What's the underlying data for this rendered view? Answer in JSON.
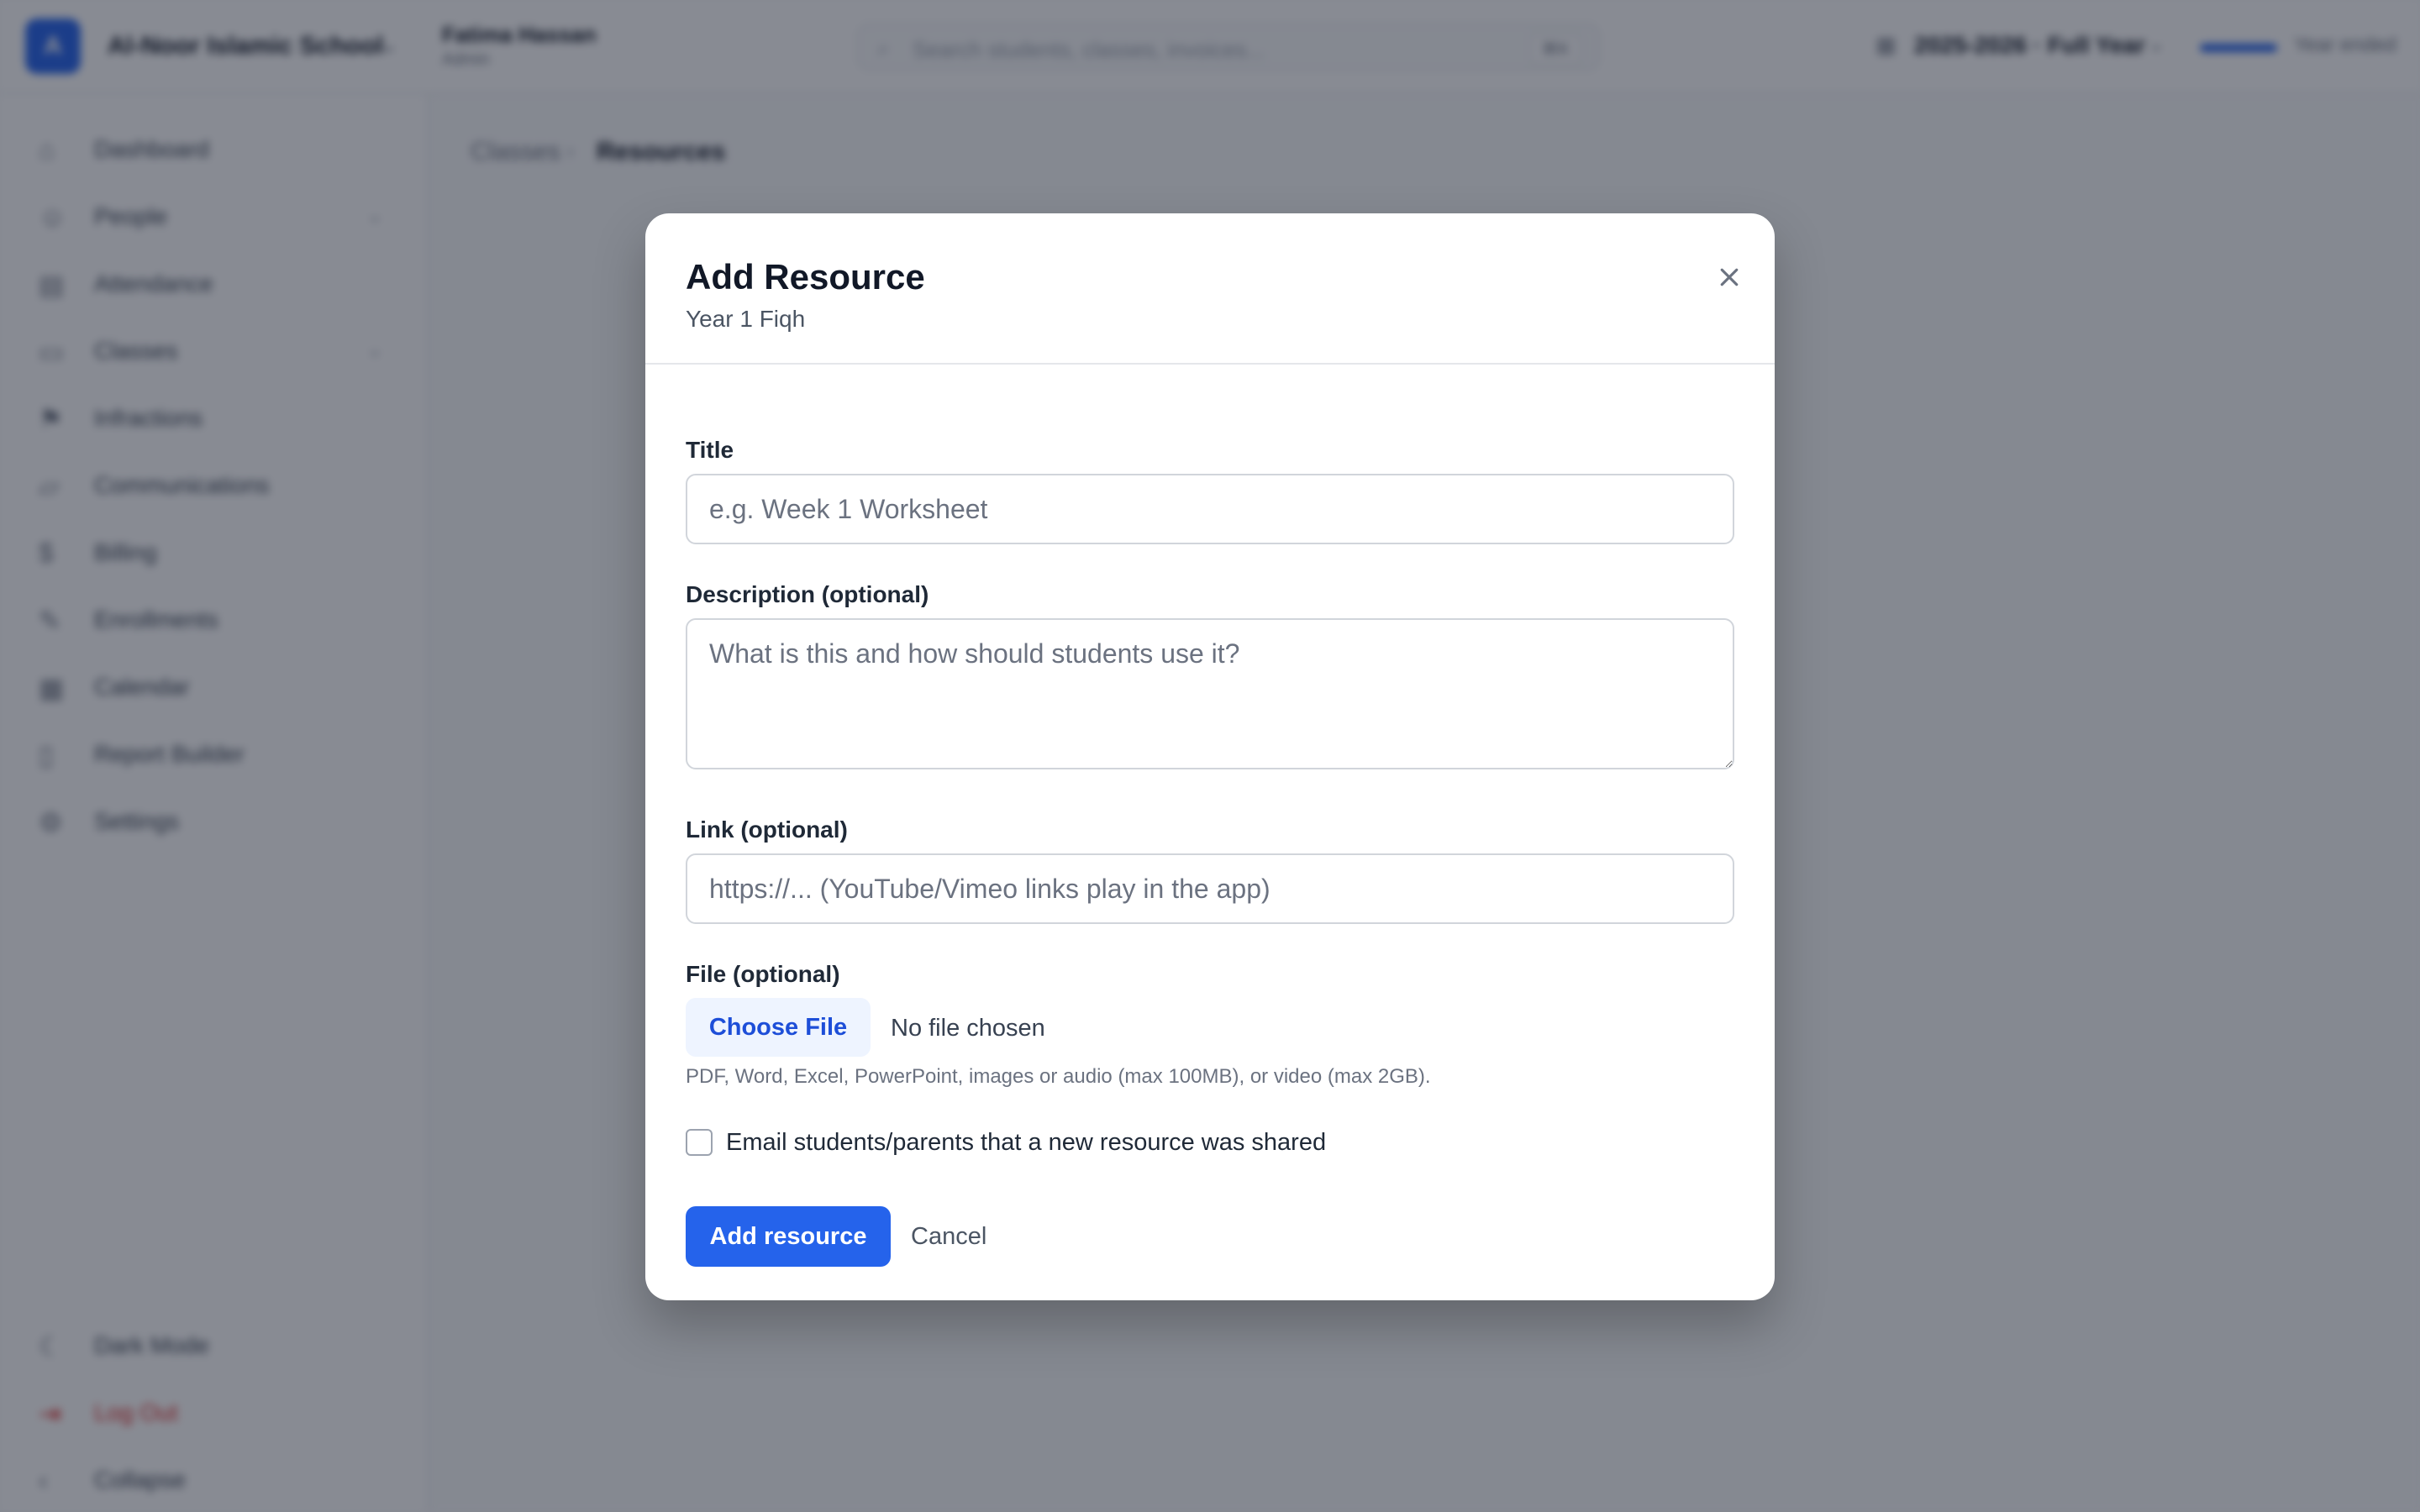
{
  "topbar": {
    "logo_letter": "A",
    "school_name": "Al-Noor Islamic School",
    "user_name": "Fatima Hassan",
    "user_role": "Admin",
    "search_placeholder": "Search students, classes, invoices...",
    "search_shortcut": "⌘K",
    "academic_year": "2025-2026 · Full Year",
    "status_text": "Year ended"
  },
  "sidebar": {
    "items": [
      {
        "label": "Dashboard",
        "icon": "home-icon"
      },
      {
        "label": "People",
        "icon": "people-icon"
      },
      {
        "label": "Attendance",
        "icon": "clipboard-icon"
      },
      {
        "label": "Classes",
        "icon": "book-icon"
      },
      {
        "label": "Infractions",
        "icon": "flag-icon"
      },
      {
        "label": "Communications",
        "icon": "message-icon"
      },
      {
        "label": "Billing",
        "icon": "dollar-icon"
      },
      {
        "label": "Enrollments",
        "icon": "enroll-icon"
      },
      {
        "label": "Calendar",
        "icon": "calendar-icon"
      },
      {
        "label": "Report Builder",
        "icon": "report-icon"
      },
      {
        "label": "Settings",
        "icon": "gear-icon"
      }
    ],
    "footer": [
      {
        "label": "Dark Mode",
        "icon": "moon-icon"
      },
      {
        "label": "Log Out",
        "icon": "logout-icon"
      },
      {
        "label": "Collapse",
        "icon": "chevron-left-icon"
      }
    ]
  },
  "breadcrumb": {
    "parent": "Classes",
    "current": "Resources"
  },
  "modal": {
    "title": "Add Resource",
    "subtitle": "Year 1 Fiqh",
    "title_label": "Title",
    "title_placeholder": "e.g. Week 1 Worksheet",
    "description_label": "Description (optional)",
    "description_placeholder": "What is this and how should students use it?",
    "link_label": "Link (optional)",
    "link_placeholder": "https://... (YouTube/Vimeo links play in the app)",
    "file_label": "File (optional)",
    "choose_file_label": "Choose File",
    "file_status": "No file chosen",
    "file_hint": "PDF, Word, Excel, PowerPoint, images or audio (max 100MB), or video (max 2GB).",
    "notify_label": "Email students/parents that a new resource was shared",
    "submit_label": "Add resource",
    "cancel_label": "Cancel"
  },
  "colors": {
    "accent": "#2563eb",
    "overlay": "#111827",
    "logout": "#dc2626"
  }
}
